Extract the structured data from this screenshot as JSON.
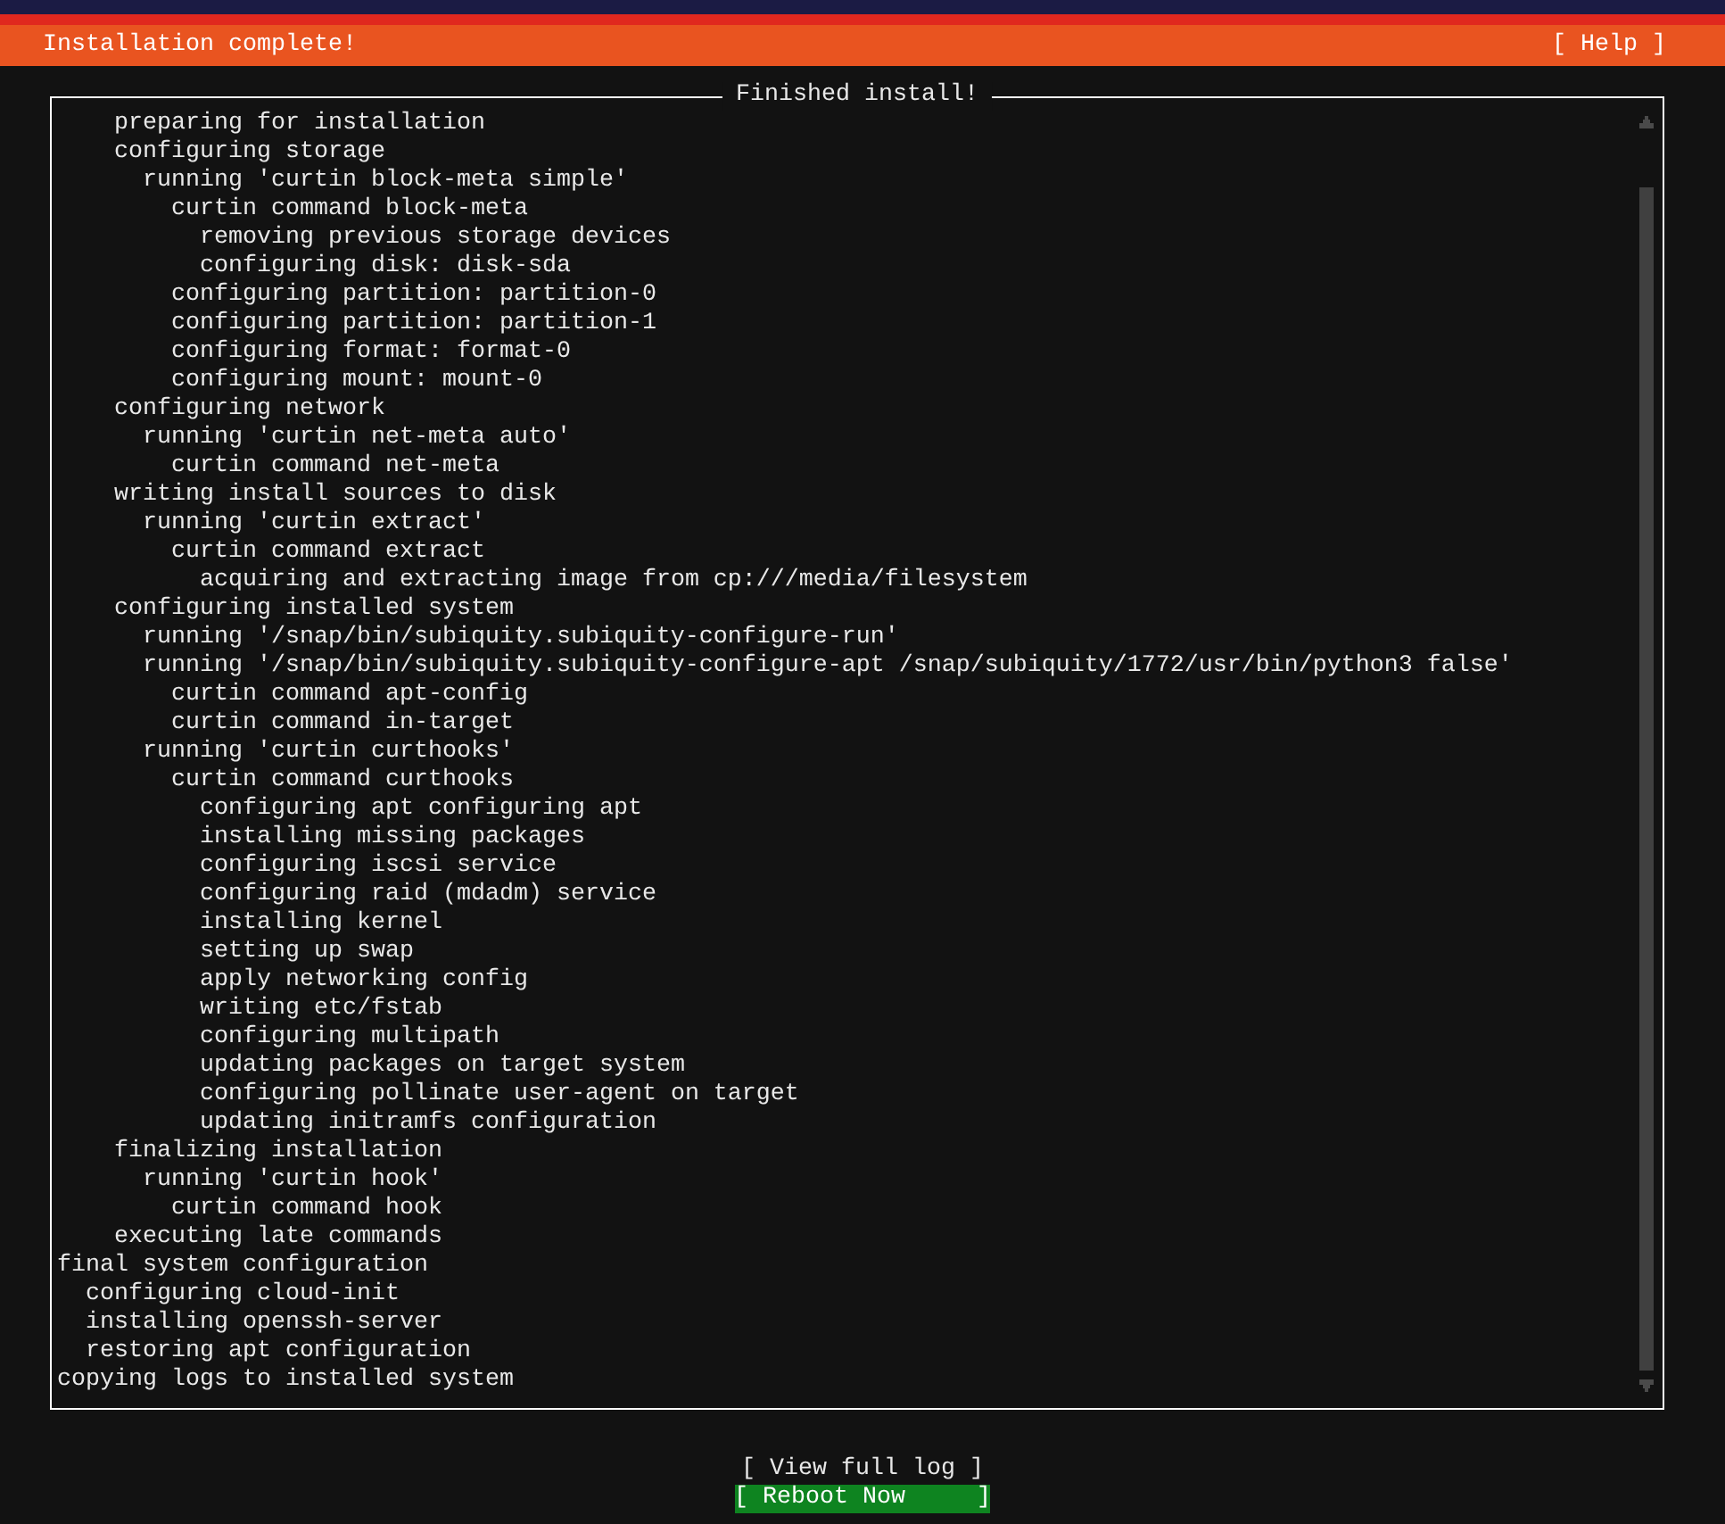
{
  "header": {
    "title": "Installation complete!",
    "help": "[ Help ]"
  },
  "panel": {
    "title": "Finished install!"
  },
  "log": [
    {
      "children": [
        {
          "children": [
            {
              "text": "preparing for installation"
            },
            {
              "text": "configuring storage",
              "children": [
                {
                  "text": "running 'curtin block-meta simple'",
                  "children": [
                    {
                      "text": "curtin command block-meta",
                      "children": [
                        {
                          "text": "removing previous storage devices"
                        },
                        {
                          "text": "configuring disk: disk-sda"
                        }
                      ]
                    },
                    {
                      "text": "configuring partition: partition-0"
                    },
                    {
                      "text": "configuring partition: partition-1"
                    },
                    {
                      "text": "configuring format: format-0"
                    },
                    {
                      "text": "configuring mount: mount-0"
                    }
                  ]
                }
              ]
            },
            {
              "text": "configuring network",
              "children": [
                {
                  "text": "running 'curtin net-meta auto'",
                  "children": [
                    {
                      "text": "curtin command net-meta"
                    }
                  ]
                }
              ]
            },
            {
              "text": "writing install sources to disk",
              "children": [
                {
                  "text": "running 'curtin extract'",
                  "children": [
                    {
                      "text": "curtin command extract",
                      "children": [
                        {
                          "text": "acquiring and extracting image from cp:///media/filesystem"
                        }
                      ]
                    }
                  ]
                }
              ]
            },
            {
              "text": "configuring installed system",
              "children": [
                {
                  "text": "running '/snap/bin/subiquity.subiquity-configure-run'"
                },
                {
                  "text": "running '/snap/bin/subiquity.subiquity-configure-apt /snap/subiquity/1772/usr/bin/python3 false'",
                  "children": [
                    {
                      "text": "curtin command apt-config"
                    },
                    {
                      "text": "curtin command in-target"
                    }
                  ]
                },
                {
                  "text": "running 'curtin curthooks'",
                  "children": [
                    {
                      "text": "curtin command curthooks",
                      "children": [
                        {
                          "text": "configuring apt configuring apt"
                        },
                        {
                          "text": "installing missing packages"
                        },
                        {
                          "text": "configuring iscsi service"
                        },
                        {
                          "text": "configuring raid (mdadm) service"
                        },
                        {
                          "text": "installing kernel"
                        },
                        {
                          "text": "setting up swap"
                        },
                        {
                          "text": "apply networking config"
                        },
                        {
                          "text": "writing etc/fstab"
                        },
                        {
                          "text": "configuring multipath"
                        },
                        {
                          "text": "updating packages on target system"
                        },
                        {
                          "text": "configuring pollinate user-agent on target"
                        },
                        {
                          "text": "updating initramfs configuration"
                        }
                      ]
                    }
                  ]
                }
              ]
            },
            {
              "text": "finalizing installation",
              "children": [
                {
                  "text": "running 'curtin hook'",
                  "children": [
                    {
                      "text": "curtin command hook"
                    }
                  ]
                }
              ]
            },
            {
              "text": "executing late commands"
            }
          ]
        }
      ]
    },
    {
      "text": "final system configuration",
      "children": [
        {
          "text": "configuring cloud-init"
        },
        {
          "text": "installing openssh-server"
        },
        {
          "text": "restoring apt configuration"
        }
      ]
    },
    {
      "text": "copying logs to installed system"
    }
  ],
  "buttons": [
    {
      "text": "[ View full log ]",
      "selected": false
    },
    {
      "text": "[ Reboot Now     ]",
      "selected": true
    }
  ]
}
